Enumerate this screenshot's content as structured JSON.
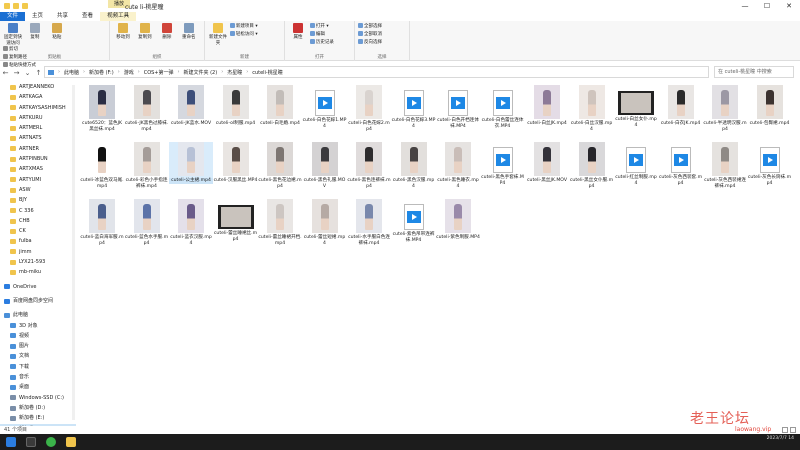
{
  "window": {
    "title": "cute li-桃星瞳",
    "context_tab": "播放",
    "controls": [
      "—",
      "☐",
      "✕"
    ]
  },
  "ribbon_tabs": [
    {
      "label": "文件",
      "style": "file"
    },
    {
      "label": "主页",
      "style": "normal"
    },
    {
      "label": "共享",
      "style": "normal"
    },
    {
      "label": "查看",
      "style": "normal"
    },
    {
      "label": "视频工具",
      "style": "tool"
    }
  ],
  "ribbon": {
    "clipboard": {
      "label": "剪贴板",
      "big": [
        {
          "label": "固定到快速访问",
          "icon": "pin-icon"
        },
        {
          "label": "复制",
          "icon": "copy-icon"
        },
        {
          "label": "粘贴",
          "icon": "paste-icon"
        }
      ],
      "small": [
        "剪切",
        "复制路径",
        "粘贴快捷方式"
      ]
    },
    "organize": {
      "label": "组织",
      "big": [
        {
          "label": "移动到",
          "icon": "move-to-icon"
        },
        {
          "label": "复制到",
          "icon": "copy-to-icon"
        },
        {
          "label": "删除",
          "icon": "delete-icon"
        },
        {
          "label": "重命名",
          "icon": "rename-icon"
        }
      ]
    },
    "new": {
      "label": "新建",
      "big": [
        {
          "label": "新建文件夹",
          "icon": "new-folder-icon"
        }
      ],
      "small": [
        "新建项目 ▾",
        "轻松访问 ▾"
      ]
    },
    "open": {
      "label": "打开",
      "big": [
        {
          "label": "属性",
          "icon": "properties-icon"
        }
      ],
      "small": [
        "打开 ▾",
        "编辑",
        "历史记录"
      ]
    },
    "select": {
      "label": "选择",
      "small": [
        "全部选择",
        "全部取消",
        "反向选择"
      ]
    }
  },
  "address": {
    "path": [
      "此电脑",
      "新加卷 (F:)",
      "游戏",
      "COS+第一弹",
      "新建文件夹 (2)",
      "杰星瞳",
      "cuteli-桃星瞳"
    ],
    "search_placeholder": "在 cuteli-桃星瞳 中搜索"
  },
  "sidebar": [
    {
      "label": "ARTJEANNEKO",
      "type": "folder"
    },
    {
      "label": "ARTKAGA",
      "type": "folder"
    },
    {
      "label": "ARTKAYSASHIMISH",
      "type": "folder"
    },
    {
      "label": "ARTKURU",
      "type": "folder"
    },
    {
      "label": "ARTMERL",
      "type": "folder"
    },
    {
      "label": "ARTNATS",
      "type": "folder"
    },
    {
      "label": "ARTNER",
      "type": "folder"
    },
    {
      "label": "ARTPINBUN",
      "type": "folder"
    },
    {
      "label": "ARTXMAS",
      "type": "folder"
    },
    {
      "label": "ARTYUMI",
      "type": "folder"
    },
    {
      "label": "ASW",
      "type": "folder"
    },
    {
      "label": "BJY",
      "type": "folder"
    },
    {
      "label": "C 336",
      "type": "folder"
    },
    {
      "label": "CHB",
      "type": "folder"
    },
    {
      "label": "CK",
      "type": "folder"
    },
    {
      "label": "fulba",
      "type": "folder"
    },
    {
      "label": "jimm",
      "type": "folder"
    },
    {
      "label": "LYX21-593",
      "type": "folder"
    },
    {
      "label": "mb-miku",
      "type": "folder"
    },
    {
      "label": "",
      "type": "spacer"
    },
    {
      "label": "OneDrive",
      "type": "cloud"
    },
    {
      "label": "",
      "type": "spacer"
    },
    {
      "label": "百度网盘同步空间",
      "type": "cloud"
    },
    {
      "label": "",
      "type": "spacer"
    },
    {
      "label": "此电脑",
      "type": "pc"
    },
    {
      "label": "3D 对象",
      "type": "pc"
    },
    {
      "label": "视频",
      "type": "pc"
    },
    {
      "label": "图片",
      "type": "pc"
    },
    {
      "label": "文档",
      "type": "pc"
    },
    {
      "label": "下载",
      "type": "pc"
    },
    {
      "label": "音乐",
      "type": "pc"
    },
    {
      "label": "桌面",
      "type": "pc"
    },
    {
      "label": "Windows-SSD (C:)",
      "type": "drive"
    },
    {
      "label": "新加卷 (D:)",
      "type": "drive"
    },
    {
      "label": "新加卷 (E:)",
      "type": "drive"
    },
    {
      "label": "新加卷 (F:)",
      "type": "drive",
      "selected": true
    }
  ],
  "files": [
    {
      "label": "cute6520：蓝色JK黑丝袜.mp4",
      "kind": "photo",
      "c1": "#c9cdd6",
      "c2": "#2a2d44",
      "selected": false
    },
    {
      "label": "cuteli-JK黑色过膝袜.mp4",
      "kind": "photo",
      "c1": "#e3e0dd",
      "c2": "#4c4a4f"
    },
    {
      "label": "cuteli-JK蓝水.MOV",
      "kind": "photo",
      "c1": "#d5d8df",
      "c2": "#3c4e7a"
    },
    {
      "label": "cuteli-ol制服.mp4",
      "kind": "photo",
      "c1": "#e8e6e4",
      "c2": "#3a3a3a"
    },
    {
      "label": "cuteli-白毛婚.mp4",
      "kind": "photo",
      "c1": "#e6e2df",
      "c2": "#c2bcb8"
    },
    {
      "label": "cuteli-白色花嫁1.MP4",
      "kind": "video"
    },
    {
      "label": "cuteli-白色花嫁2.mp4",
      "kind": "photo",
      "c1": "#ece9e6",
      "c2": "#d9d3cf"
    },
    {
      "label": "cuteli-白色花嫁3.MP4",
      "kind": "video"
    },
    {
      "label": "cuteli-白色开档连体袜.MP4",
      "kind": "video"
    },
    {
      "label": "cuteli-白色蕾丝连体衣.MP4",
      "kind": "video"
    },
    {
      "label": "cuteli-白丝JK.mp4",
      "kind": "photo",
      "c1": "#e4dce6",
      "c2": "#8d7a97"
    },
    {
      "label": "cuteli-白丝汉服.mp4",
      "kind": "photo",
      "c1": "#eee8e4",
      "c2": "#cfc4bd"
    },
    {
      "label": "cuteli-白丝女仆.mp4",
      "kind": "film"
    },
    {
      "label": "cuteli-白衣JK.mp4",
      "kind": "photo",
      "c1": "#e9e6e4",
      "c2": "#2b2b2b"
    },
    {
      "label": "cuteli-半透明汉服.mp4",
      "kind": "photo",
      "c1": "#e2e0e4",
      "c2": "#9c98a4"
    },
    {
      "label": "cuteli-包臀裙.mp4",
      "kind": "photo",
      "c1": "#e6e2de",
      "c2": "#3c3330"
    },
    {
      "label": "cuteli-冰蓝色双马尾.mp4",
      "kind": "photo",
      "c1": "#ffffff",
      "c2": "#111111"
    },
    {
      "label": "cuteli-彩色小手指连裤袜.mp4",
      "kind": "photo",
      "c1": "#e6e3e0",
      "c2": "#a49c98"
    },
    {
      "label": "cuteli-公主裙.mp4",
      "kind": "photo",
      "c1": "#e4e7ee",
      "c2": "#b7c1d6",
      "selected": true
    },
    {
      "label": "cuteli-汉服黑丝.MP4",
      "kind": "photo",
      "c1": "#e9e5e2",
      "c2": "#5a4e48"
    },
    {
      "label": "cuteli-黑色花边裙.mp4",
      "kind": "photo",
      "c1": "#dcd8d6",
      "c2": "#7d7672"
    },
    {
      "label": "cuteli-黑色礼服.MOV",
      "kind": "photo",
      "c1": "#d4d2d3",
      "c2": "#3b3a3d"
    },
    {
      "label": "cuteli-黑色连裤袜.mp4",
      "kind": "photo",
      "c1": "#e0dcdc",
      "c2": "#2e2c2e"
    },
    {
      "label": "cuteli-黑色汉服.mp4",
      "kind": "photo",
      "c1": "#e2dfdc",
      "c2": "#484343"
    },
    {
      "label": "cuteli-黑色睡衣.mp4",
      "kind": "photo",
      "c1": "#e6e3e1",
      "c2": "#c9bdb8"
    },
    {
      "label": "cuteli-黑色手套袜.MP4",
      "kind": "video"
    },
    {
      "label": "cuteli-黑丝JK.MOV",
      "kind": "photo",
      "c1": "#e3e1e2",
      "c2": "#34323a"
    },
    {
      "label": "cuteli-黑丝女仆服.mp4",
      "kind": "photo",
      "c1": "#d9d8da",
      "c2": "#26252a"
    },
    {
      "label": "cuteli-红丝制服.mp4",
      "kind": "video"
    },
    {
      "label": "cuteli-灰色西装套.mp4",
      "kind": "video"
    },
    {
      "label": "cuteli-灰色西装裙连裤袜.mp4",
      "kind": "photo",
      "c1": "#e5e2df",
      "c2": "#8f8a86"
    },
    {
      "label": "cuteli-灰色长筒袜.mp4",
      "kind": "video"
    },
    {
      "label": "cuteli-蓝白海军服.mp4",
      "kind": "photo",
      "c1": "#e1e4ea",
      "c2": "#4a5e8c"
    },
    {
      "label": "cuteli-蓝色水手服.mp4",
      "kind": "photo",
      "c1": "#e2e5ec",
      "c2": "#5c73a8"
    },
    {
      "label": "cuteli-蓝衣汉服.mp4",
      "kind": "photo",
      "c1": "#e4e0ea",
      "c2": "#6a5b8a"
    },
    {
      "label": "cuteli-蕾丝睡裙丝.mp4",
      "kind": "film"
    },
    {
      "label": "cuteli-蕾丝睡裙开档.mp4",
      "kind": "photo",
      "c1": "#e9e6e4",
      "c2": "#cdc6c2"
    },
    {
      "label": "cuteli-蕾丝短裙.mp4",
      "kind": "photo",
      "c1": "#e6e1de",
      "c2": "#b6aaa4"
    },
    {
      "label": "cuteli-水手服白色连裤袜.mp4",
      "kind": "photo",
      "c1": "#e4e6ec",
      "c2": "#7988ac"
    },
    {
      "label": "cuteli-紫色吊带连裤袜.MP4",
      "kind": "video"
    },
    {
      "label": "cuteli-紫色制服.MP4",
      "kind": "photo",
      "c1": "#e6e1e9",
      "c2": "#9a8aaa"
    }
  ],
  "status": {
    "text": "41 个项目"
  },
  "taskbar": {
    "time": "2023/7/7 14"
  },
  "watermark": {
    "main": "老王论坛",
    "sub": "laowang.vip"
  }
}
